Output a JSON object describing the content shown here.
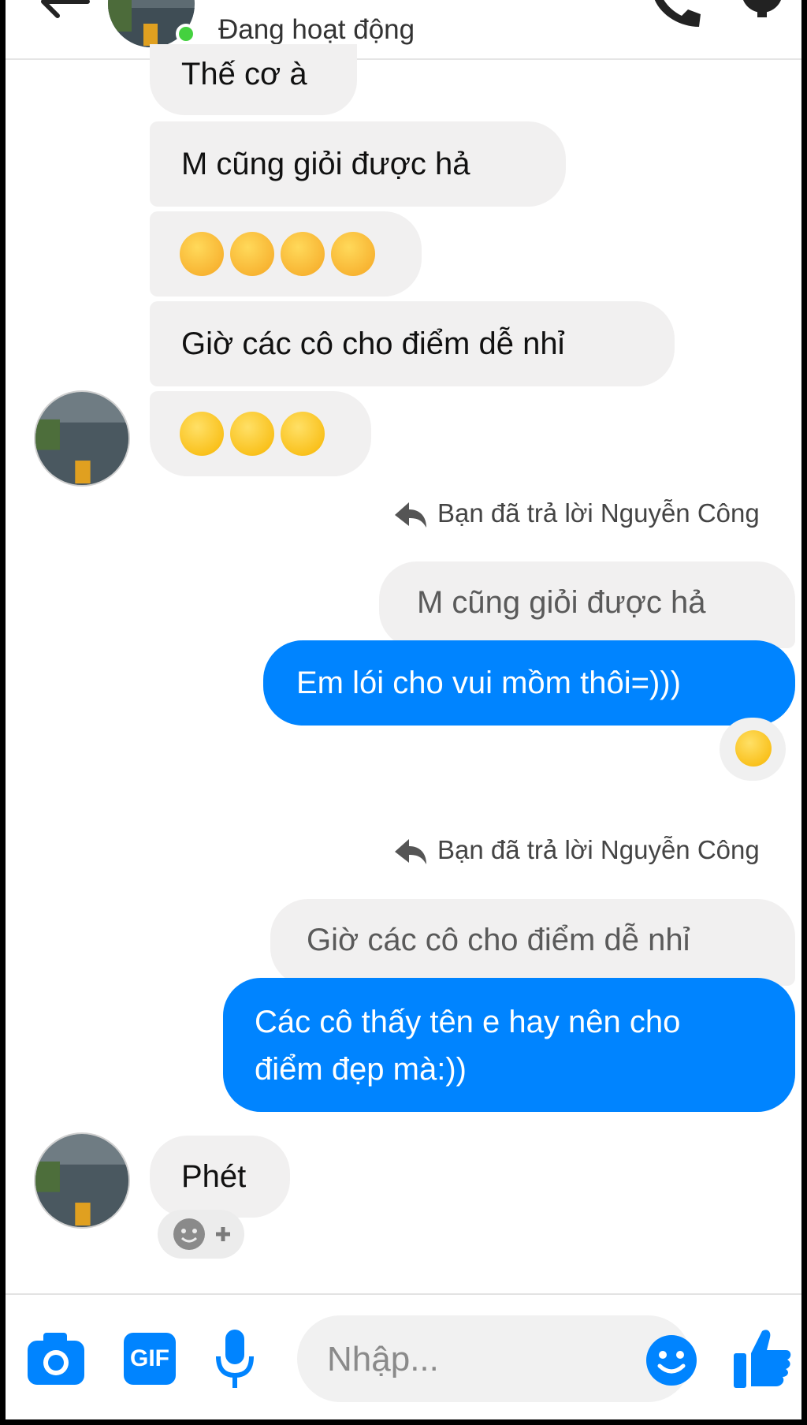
{
  "header": {
    "status": "Đang hoạt động"
  },
  "messages": {
    "m1": "Thế cơ à",
    "m2": "M cũng giỏi được hả",
    "m3_emoji": [
      "thinking-face",
      "thinking-face",
      "thinking-face",
      "thinking-face"
    ],
    "m4": "Giờ các cô cho điểm dễ nhỉ",
    "m5_emoji": [
      "tears-of-joy",
      "tears-of-joy",
      "tears-of-joy"
    ],
    "reply_note_1": "Bạn đã trả lời Nguyễn Công",
    "quote_1": "M cũng giỏi được hả",
    "out_1": "Em lói cho vui mồm thôi=)))",
    "reaction_1": "laughing-face",
    "reply_note_2": "Bạn đã trả lời Nguyễn Công",
    "quote_2": "Giờ các cô cho điểm dễ nhỉ",
    "out_2_line1": "Các cô thấy tên e hay nên cho",
    "out_2_line2": "điểm đẹp mà:))",
    "m6": "Phét"
  },
  "composer": {
    "gif_label": "GIF",
    "placeholder": "Nhập..."
  },
  "colors": {
    "accent": "#0084ff",
    "incoming_bubble": "#f1f0f0",
    "online": "#44d13f"
  }
}
